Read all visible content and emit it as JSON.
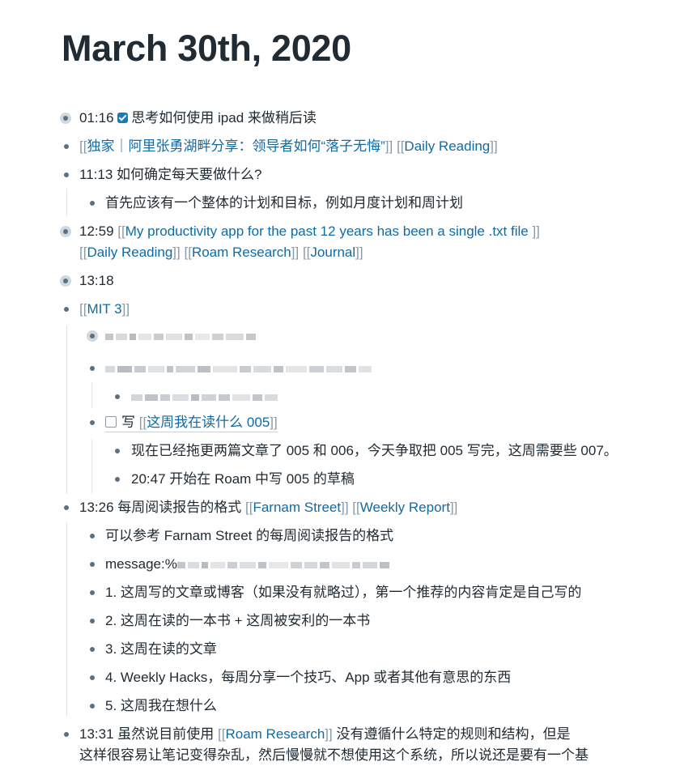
{
  "page": {
    "title": "March 30th, 2020"
  },
  "blocks": {
    "b1": {
      "time": "01:16",
      "text": "思考如何使用 ipad 来做稍后读"
    },
    "b2": {
      "open1": "[[",
      "ref1": "独家｜阿里张勇湖畔分享：领导者如何“落子无悔”",
      "close1": "]]",
      "open2": "[[",
      "ref2": "Daily Reading",
      "close2": "]]"
    },
    "b3": {
      "text": "11:13 如何确定每天要做什么?"
    },
    "b3a": {
      "text": "首先应该有一个整体的计划和目标，例如月度计划和周计划"
    },
    "b4": {
      "time": "12:59",
      "ref1": "My productivity app for the past 12 years has been a single .txt file ",
      "ref2": "Daily Reading",
      "ref3": "Roam Research",
      "ref4": "Journal",
      "open": "[[",
      "close": "]]"
    },
    "b5": {
      "text": "13:18"
    },
    "b6": {
      "ref": "MIT 3",
      "open": "[[",
      "close": "]]"
    },
    "b6c": {
      "prefix": "写",
      "ref": "这周我在读什么 005",
      "open": "[[",
      "close": "]]"
    },
    "b6c1": {
      "text": "现在已经拖更两篇文章了 005 和 006，今天争取把 005 写完，这周需要些 007。"
    },
    "b6c2": {
      "text": "20:47 开始在 Roam 中写 005 的草稿"
    },
    "b7": {
      "text": "13:26 每周阅读报告的格式",
      "ref1": "Farnam Street",
      "ref2": "Weekly Report",
      "open": "[[",
      "close": "]]"
    },
    "b7a": {
      "text": "可以参考 Farnam Street 的每周阅读报告的格式"
    },
    "b7b": {
      "text": "message:%"
    },
    "b7c": {
      "text": "1. 这周写的文章或博客（如果没有就略过），第一个推荐的内容肯定是自己写的"
    },
    "b7d": {
      "text": "2. 这周在读的一本书 + 这周被安利的一本书"
    },
    "b7e": {
      "text": "3. 这周在读的文章"
    },
    "b7f": {
      "text": "4. Weekly Hacks，每周分享一个技巧、App 或者其他有意思的东西"
    },
    "b7g": {
      "text": "5. 这周我在想什么"
    },
    "b8": {
      "time": "13:31",
      "line1a": "虽然说目前使用",
      "ref": "Roam Research",
      "line1b": "没有遵循什么特定的规则和结构，但是",
      "line2": "这样很容易让笔记变得杂乱，然后慢慢就不想使用这个系统，所以说还是要有一个基",
      "open": "[[",
      "close": "]]"
    }
  }
}
